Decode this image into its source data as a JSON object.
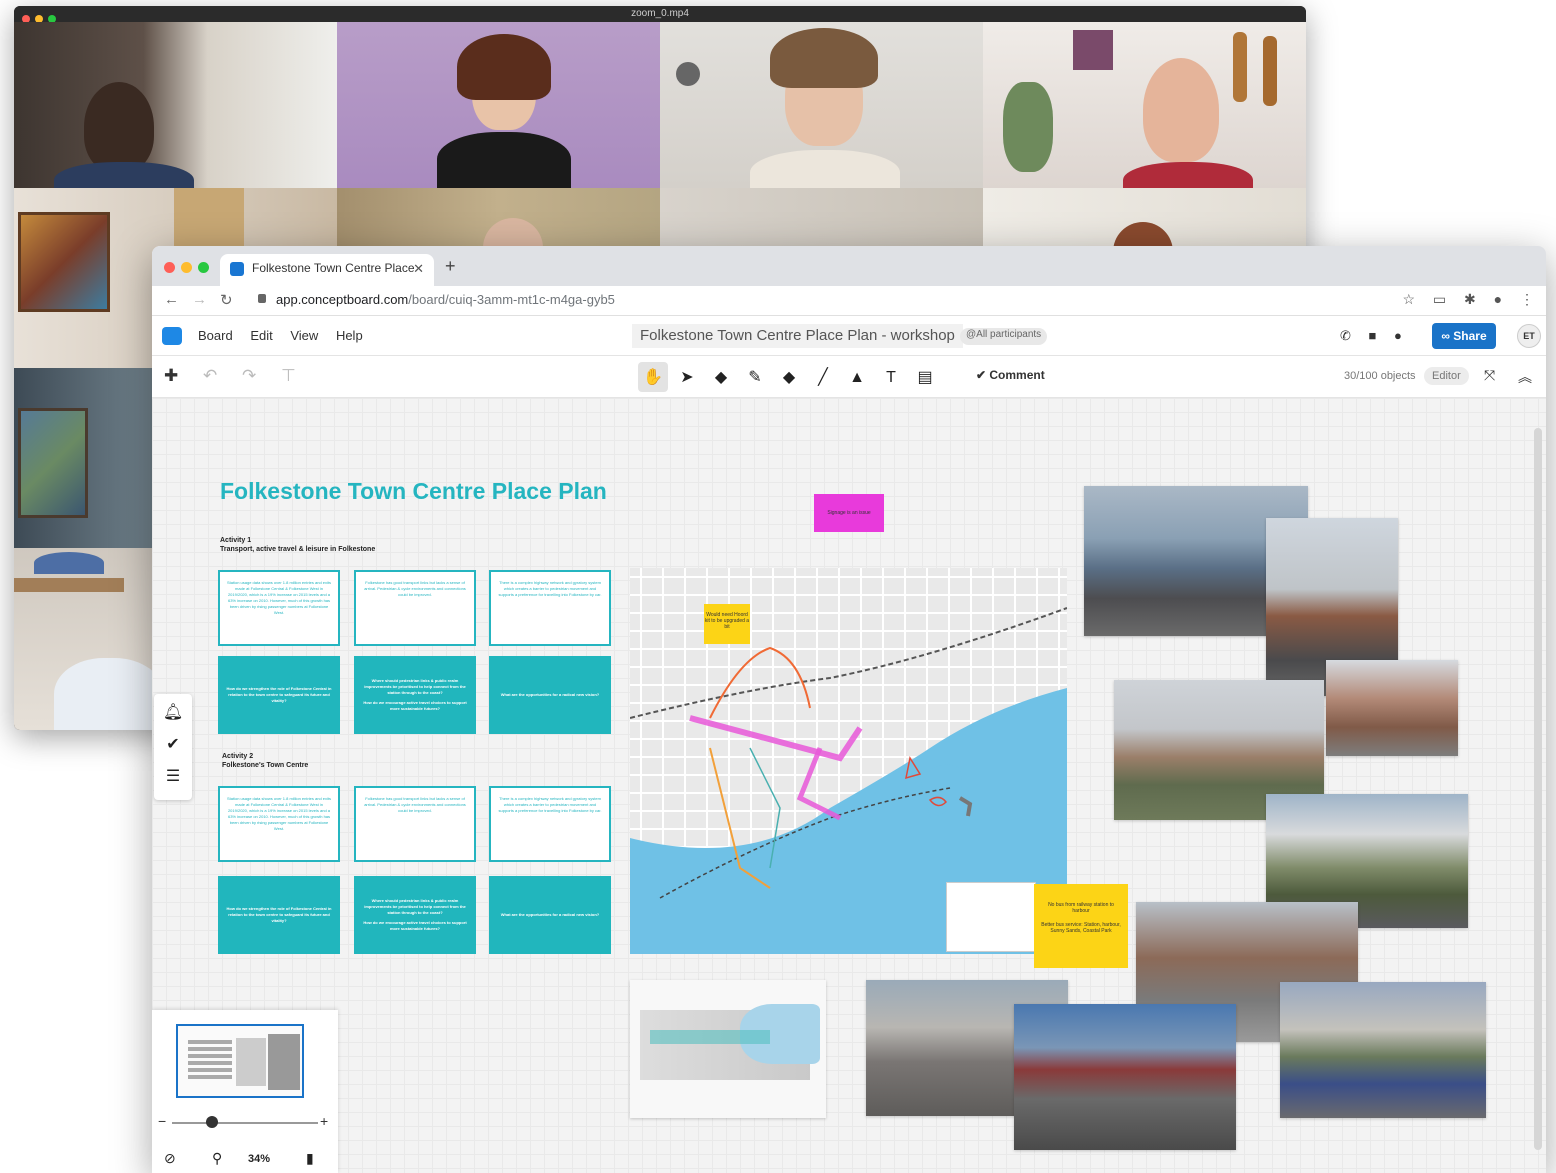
{
  "zoom_window": {
    "title": "zoom_0.mp4",
    "traffic_colors": [
      "#fe5f57",
      "#febc2e",
      "#28c840"
    ]
  },
  "browser": {
    "tab_title": "Folkestone Town Centre Place",
    "url_domain": "app.conceptboard.com",
    "url_path": "/board/cuiq-3amm-mt1c-m4ga-gyb5"
  },
  "app": {
    "menu": [
      "Board",
      "Edit",
      "View",
      "Help"
    ],
    "board_title": "Folkestone Town Centre Place Plan - workshop",
    "participants_label": "@All participants",
    "share_label": "Share",
    "avatar_initials": "ET",
    "comment_label": "Comment",
    "object_count": "30/100 objects",
    "editor_label": "Editor",
    "accent_color": "#25b5c0"
  },
  "board": {
    "heading": "Folkestone Town Centre Place Plan",
    "activity1_title": "Activity 1",
    "activity1_subtitle": "Transport, active travel & leisure in Folkestone",
    "activity2_title": "Activity 2",
    "activity2_subtitle": "Folkestone's Town Centre",
    "cards_row1": [
      "Station usage data shows over 1.8 million entries and exits made at Folkestone Central & Folkestone West in 2019/2020, which is a 19% increase on 2015 levels and a 63% increase on 2010. However, much of this growth has been driven by rising passenger numbers at Folkestone West.",
      "Folkestone has good transport links but lacks a sense of arrival. Pedestrian & cycle environments and connections could be improved.",
      "There is a complex highway network and gyratory system which creates a barrier to pedestrian movement and supports a preference for travelling into Folkestone by car."
    ],
    "cards_row2": [
      "How do we strengthen the role of Folkestone Central in relation to the town centre to safeguard its future and vitality?",
      "Where should pedestrian links & public realm improvements be prioritised to help connect from the station through to the coast?",
      "How do we encourage active travel choices to support more sustainable futures?",
      "What are the opportunities for a radical new vision?"
    ],
    "pink_note": "Signage is an issue",
    "yellow_note_1": "Would need Hoord kit to be upgraded a bit",
    "yellow_note_2a": "No bus from railway station to harbour",
    "yellow_note_2b": "Better bus service: Station, harbour, Sunny Sands, Coastal Park"
  },
  "minimap": {
    "zoom_level": "34%"
  }
}
